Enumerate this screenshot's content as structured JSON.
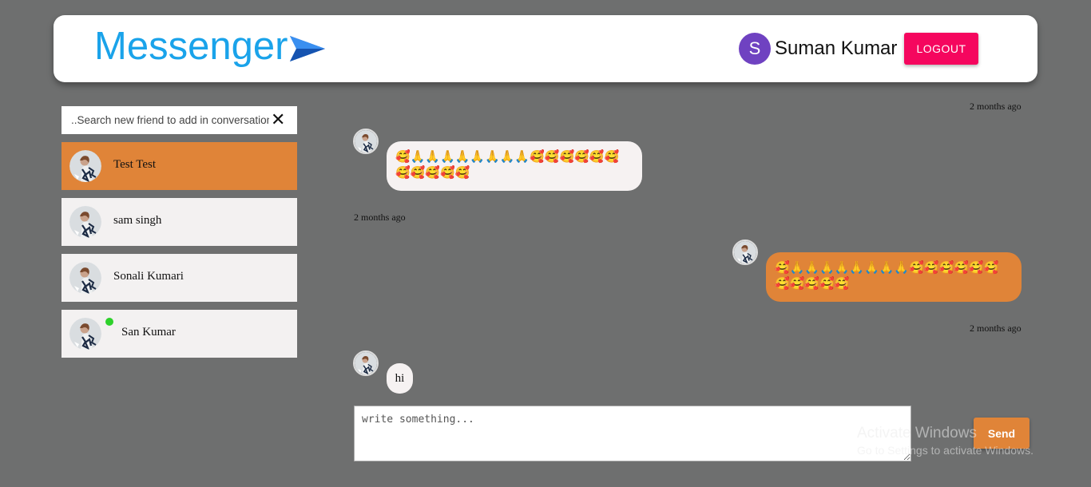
{
  "header": {
    "brand": "Messenger",
    "user_initial": "S",
    "user_name": "Suman Kumar",
    "logout_label": "LOGOUT"
  },
  "search": {
    "placeholder": "..Search new friend to add in conversation",
    "clear_icon": "close-icon"
  },
  "conversations": [
    {
      "name": "Test Test",
      "active": true,
      "online": false
    },
    {
      "name": "sam singh",
      "active": false,
      "online": false
    },
    {
      "name": "Sonali Kumari",
      "active": false,
      "online": false
    },
    {
      "name": "San Kumar",
      "active": false,
      "online": true
    }
  ],
  "messages": [
    {
      "from": "other",
      "text": "🥰🙏🙏🙏🙏🙏🙏🙏🙏🥰🥰🥰🥰🥰🥰🥰🥰🥰🥰🥰",
      "time": "2 months ago"
    },
    {
      "from": "me",
      "text": "🥰🙏🙏🙏🙏🙏🙏🙏🙏🥰🥰🥰🥰🥰🥰🥰🥰🥰🥰🥰",
      "time": "2 months ago"
    },
    {
      "from": "other",
      "text": "hi",
      "time": ""
    }
  ],
  "top_stamp": "2 months ago",
  "compose": {
    "placeholder": "write something...",
    "send_label": "Send"
  },
  "watermark": {
    "line1": "Activate Windows",
    "line2": "Go to Settings to activate Windows."
  },
  "colors": {
    "background": "#6e6f6f",
    "accent": "#e08438",
    "brand": "#1aa3ea",
    "logout": "#f5065e",
    "avatar": "#6f42c1",
    "online": "#2ed12b"
  }
}
